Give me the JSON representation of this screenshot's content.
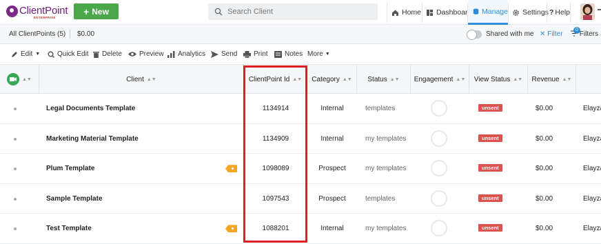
{
  "brand": {
    "name": "ClientPoint",
    "sub": "ENTERPRISE"
  },
  "header": {
    "new_label": "New",
    "search_placeholder": "Search Client",
    "nav": [
      {
        "label": "Home",
        "icon": "home-icon"
      },
      {
        "label": "Dashboard",
        "icon": "dashboard-icon"
      },
      {
        "label": "Manage",
        "icon": "database-icon",
        "active": true
      },
      {
        "label": "Settings",
        "icon": "gear-icon"
      },
      {
        "label": "Help",
        "icon": "question-icon"
      }
    ]
  },
  "subbar": {
    "count_label": "All ClientPoints (5)",
    "amount": "$0.00",
    "shared_label": "Shared with me",
    "filter_label": "Filter",
    "filters_label": "Filters",
    "filters_badge": "0"
  },
  "toolbar": {
    "edit": "Edit",
    "quick_edit": "Quick Edit",
    "delete": "Delete",
    "preview": "Preview",
    "analytics": "Analytics",
    "send": "Send",
    "print": "Print",
    "notes": "Notes",
    "more": "More"
  },
  "table": {
    "columns": [
      "Client",
      "ClientPoint Id",
      "Category",
      "Status",
      "Engagement",
      "View Status",
      "Revenue"
    ],
    "rows": [
      {
        "client": "Legal Documents Template",
        "id": "1134914",
        "category": "Internal",
        "status": "templates",
        "view_status": "unsent",
        "revenue": "$0.00",
        "owner": "Elayza",
        "tag": false
      },
      {
        "client": "Marketing Material Template",
        "id": "1134909",
        "category": "Internal",
        "status": "my templates",
        "view_status": "unsent",
        "revenue": "$0.00",
        "owner": "Elayza",
        "tag": false
      },
      {
        "client": "Plum Template",
        "id": "1098089",
        "category": "Prospect",
        "status": "my templates",
        "view_status": "unsent",
        "revenue": "$0.00",
        "owner": "Elayza",
        "tag": true
      },
      {
        "client": "Sample Template",
        "id": "1097543",
        "category": "Prospect",
        "status": "templates",
        "view_status": "unsent",
        "revenue": "$0.00",
        "owner": "Elayza",
        "tag": false
      },
      {
        "client": "Test Template",
        "id": "1088201",
        "category": "Internal",
        "status": "my templates",
        "view_status": "unsent",
        "revenue": "$0.00",
        "owner": "Elayza",
        "tag": true
      }
    ]
  },
  "colors": {
    "accent": "#2d8ed6",
    "new_button": "#4aa84a",
    "unsent": "#d9534f",
    "highlight": "#e11d24",
    "brand": "#7b2a86"
  }
}
